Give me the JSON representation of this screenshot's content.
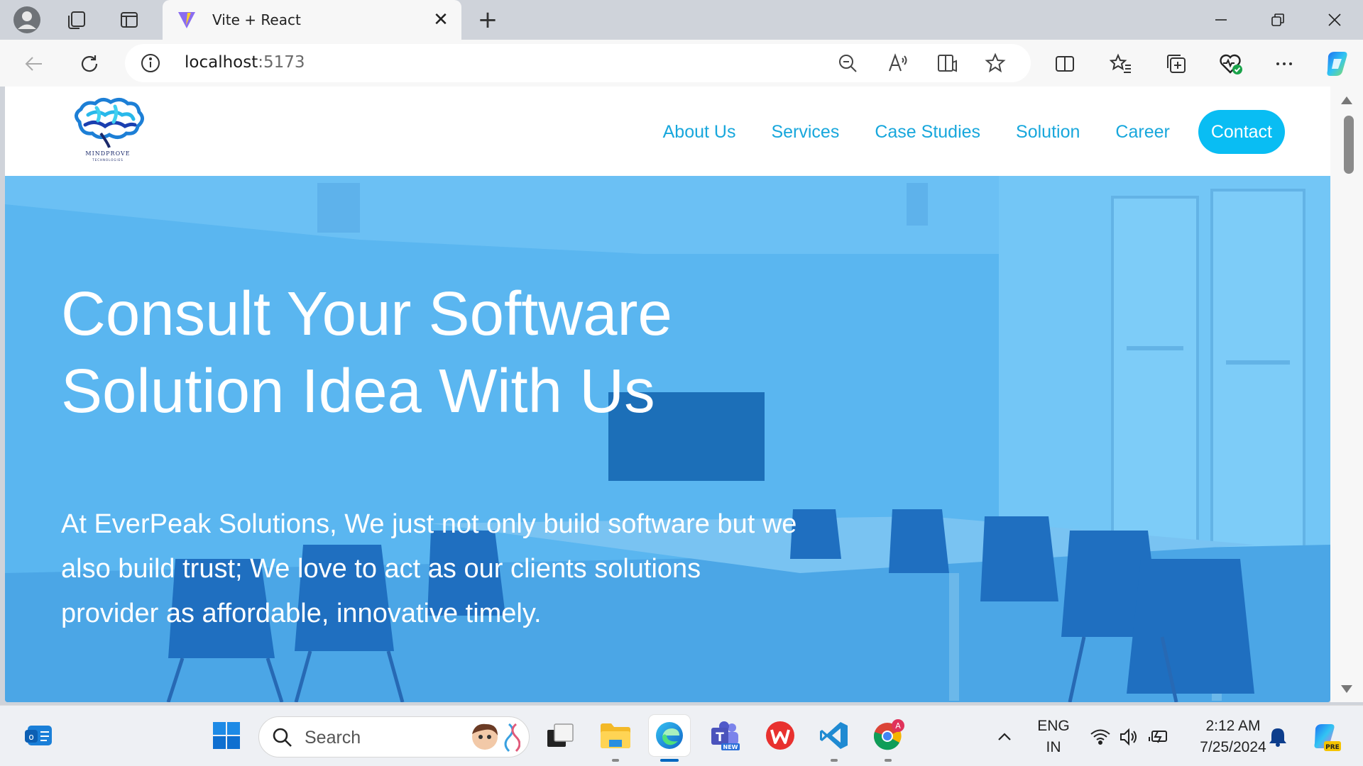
{
  "browser": {
    "tab_title": "Vite + React",
    "tab_close": "✕",
    "new_tab": "+",
    "url_host": "localhost",
    "url_port": ":5173"
  },
  "site": {
    "logo_text": "MINDPROVE",
    "logo_subtext": "TECHNOLOGIES",
    "nav": [
      {
        "label": "About Us"
      },
      {
        "label": "Services"
      },
      {
        "label": "Case Studies"
      },
      {
        "label": "Solution"
      },
      {
        "label": "Career"
      }
    ],
    "contact_label": "Contact",
    "hero_title_line1": "Consult Your Software",
    "hero_title_line2": "Solution Idea With Us",
    "hero_text_line1": "At EverPeak Solutions, We just not only build software but we",
    "hero_text_line2": "also build trust; We love to act as our clients solutions",
    "hero_text_line3": "provider as affordable, innovative timely.",
    "colors": {
      "nav_text": "#18a7dc",
      "contact_bg": "#09bdf3",
      "hero_overlay": "#5ab6f0"
    }
  },
  "taskbar": {
    "search_label": "Search",
    "language": "ENG",
    "region": "IN",
    "time": "2:12 AM",
    "date": "7/25/2024",
    "chrome_badge": "A",
    "copilot_badge": "PRE",
    "teams_badge": "NEW"
  }
}
